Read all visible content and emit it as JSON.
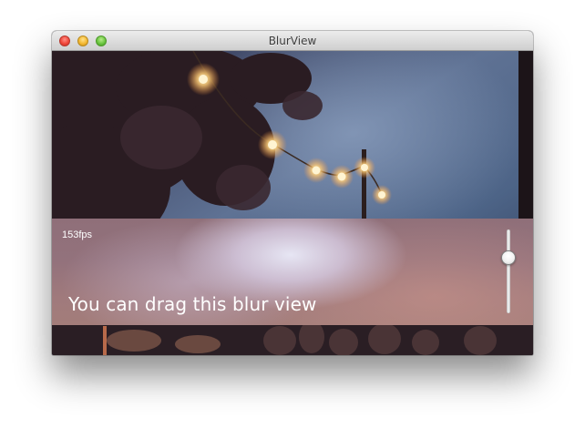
{
  "window": {
    "title": "BlurView"
  },
  "window_controls": {
    "close": "close-button",
    "minimize": "minimize-button",
    "zoom": "zoom-button"
  },
  "blur_view": {
    "fps_label": "153fps",
    "caption": "You can drag this blur view"
  },
  "slider": {
    "value": 0.3,
    "orientation": "vertical"
  }
}
